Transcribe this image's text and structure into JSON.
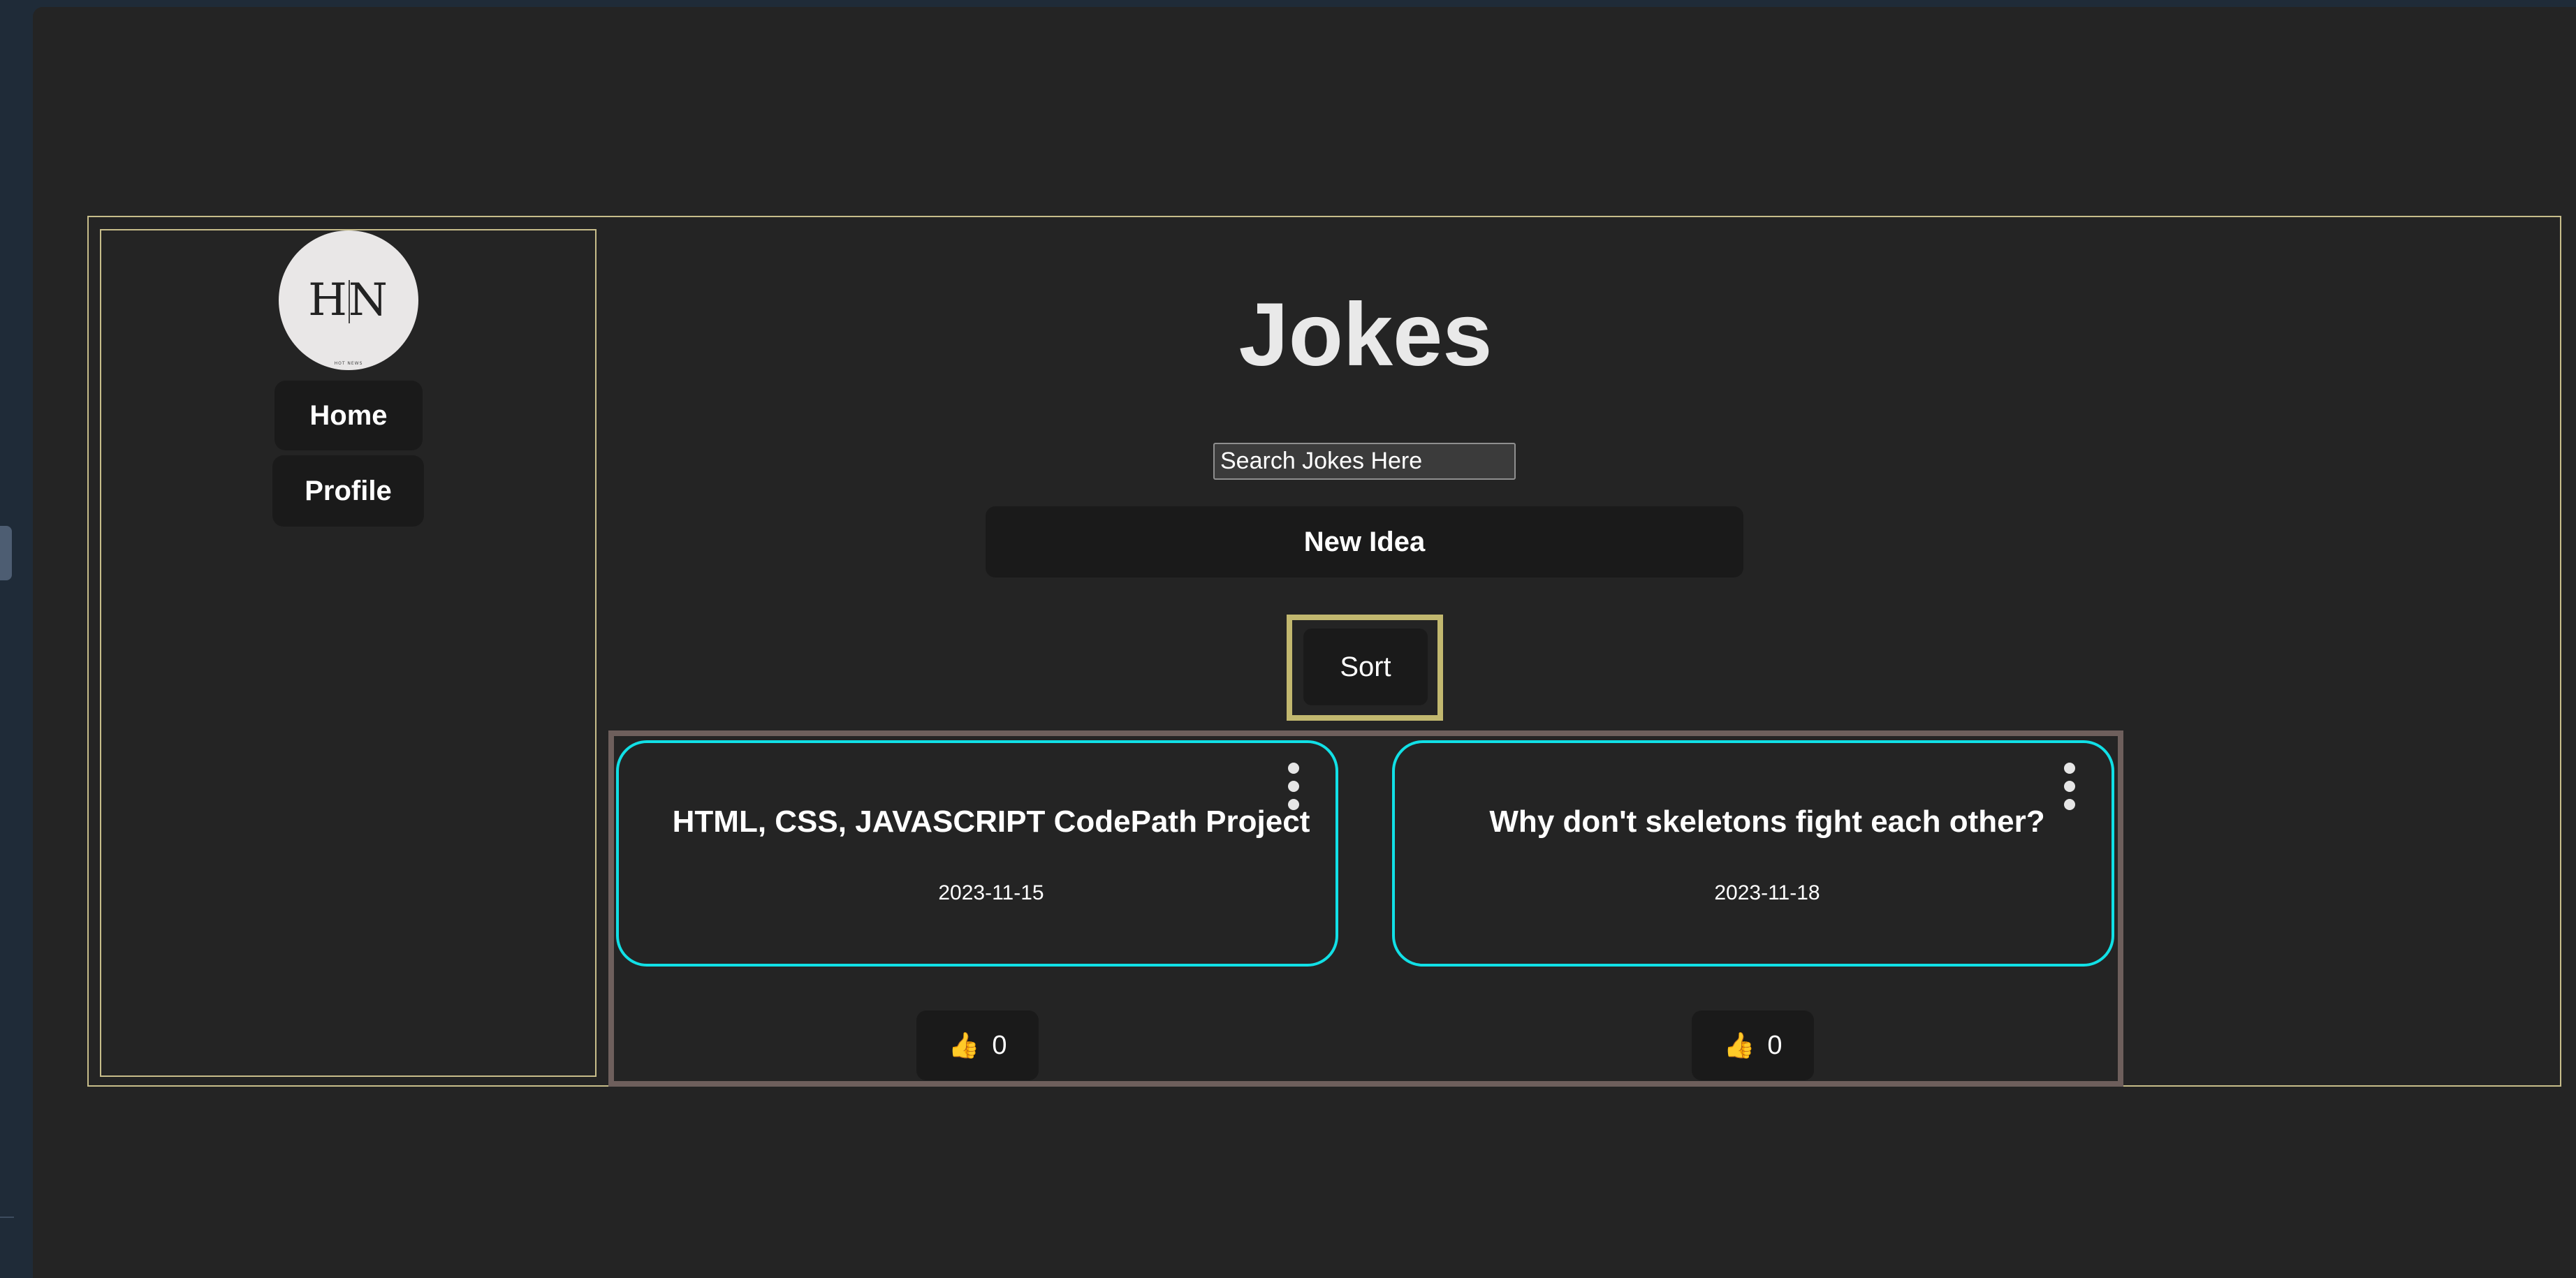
{
  "sidebar": {
    "logo": {
      "text": "HN",
      "subtext": "HOT NEWS"
    },
    "items": [
      {
        "label": "Home"
      },
      {
        "label": "Profile"
      }
    ]
  },
  "main": {
    "title": "Jokes",
    "search": {
      "placeholder": "Search Jokes Here",
      "value": ""
    },
    "new_idea_label": "New Idea",
    "sort_label": "Sort",
    "posts": [
      {
        "title": "HTML, CSS, JAVASCRIPT CodePath Project",
        "date": "2023-11-15",
        "likes": "0"
      },
      {
        "title": "Why don't skeletons fight each other?",
        "date": "2023-11-18",
        "likes": "0"
      }
    ]
  },
  "icons": {
    "like": "thumbs-up-icon",
    "menu": "kebab-menu-icon"
  },
  "colors": {
    "card_border": "#11e0e6",
    "frame_border": "#c7bd8a",
    "sort_border": "#c2b86f"
  }
}
